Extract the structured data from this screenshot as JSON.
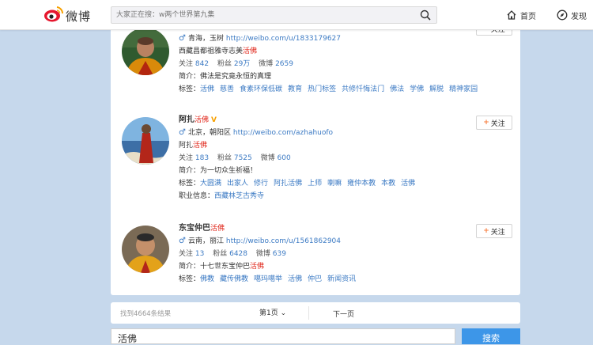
{
  "header": {
    "logo_text": "微博",
    "search_placeholder": "大家正在搜：w两个世界第九集",
    "nav_home": "首页",
    "nav_discover": "发现"
  },
  "users": [
    {
      "location": "青海，玉树",
      "url": "http://weibo.com/u/1833179627",
      "desc_prefix": "西藏昌都祖雅寺志美",
      "desc_highlight": "活佛",
      "following_label": "关注",
      "following": "842",
      "followers_label": "粉丝",
      "followers": "29万",
      "posts_label": "微博",
      "posts": "2659",
      "bio_label": "简介：",
      "bio": "佛法是究竟永恒的真理",
      "tags_label": "标签：",
      "tags": [
        "活佛",
        "慈善",
        "食素环保低碳",
        "教育",
        "热门标签",
        "共修忏悔法门",
        "佛法",
        "学佛",
        "解脱",
        "精神家园"
      ],
      "follow": "关注"
    },
    {
      "name": "阿扎",
      "name_highlight": "活佛",
      "location": "北京，朝阳区",
      "url": "http://weibo.com/azhahuofo",
      "desc_prefix": "阿扎",
      "desc_highlight": "活佛",
      "following_label": "关注",
      "following": "183",
      "followers_label": "粉丝",
      "followers": "7525",
      "posts_label": "微博",
      "posts": "600",
      "bio_label": "简介：",
      "bio": "为一切众生祈福！",
      "tags_label": "标签：",
      "tags": [
        "大圆满",
        "出家人",
        "修行",
        "阿扎活佛",
        "上师",
        "喇嘛",
        "雍仲本教",
        "本教",
        "活佛"
      ],
      "job_label": "职业信息：",
      "job": "西藏林芝古秀寺",
      "follow": "关注"
    },
    {
      "name": "东宝仲巴",
      "name_highlight": "活佛",
      "location": "云南，丽江",
      "url": "http://weibo.com/u/1561862904",
      "following_label": "关注",
      "following": "13",
      "followers_label": "粉丝",
      "followers": "6428",
      "posts_label": "微博",
      "posts": "639",
      "bio_label": "简介：",
      "bio_prefix": "十七世东宝仲巴",
      "bio_highlight": "活佛",
      "tags_label": "标签：",
      "tags": [
        "佛教",
        "藏传佛教",
        "噶玛噶举",
        "活佛",
        "仲巴",
        "新闻资讯"
      ],
      "follow": "关注"
    }
  ],
  "pager": {
    "result_count": "找到4664条结果",
    "current_page": "第1页",
    "next": "下一页"
  },
  "bottom_search": {
    "query": "活佛",
    "button": "搜索"
  }
}
